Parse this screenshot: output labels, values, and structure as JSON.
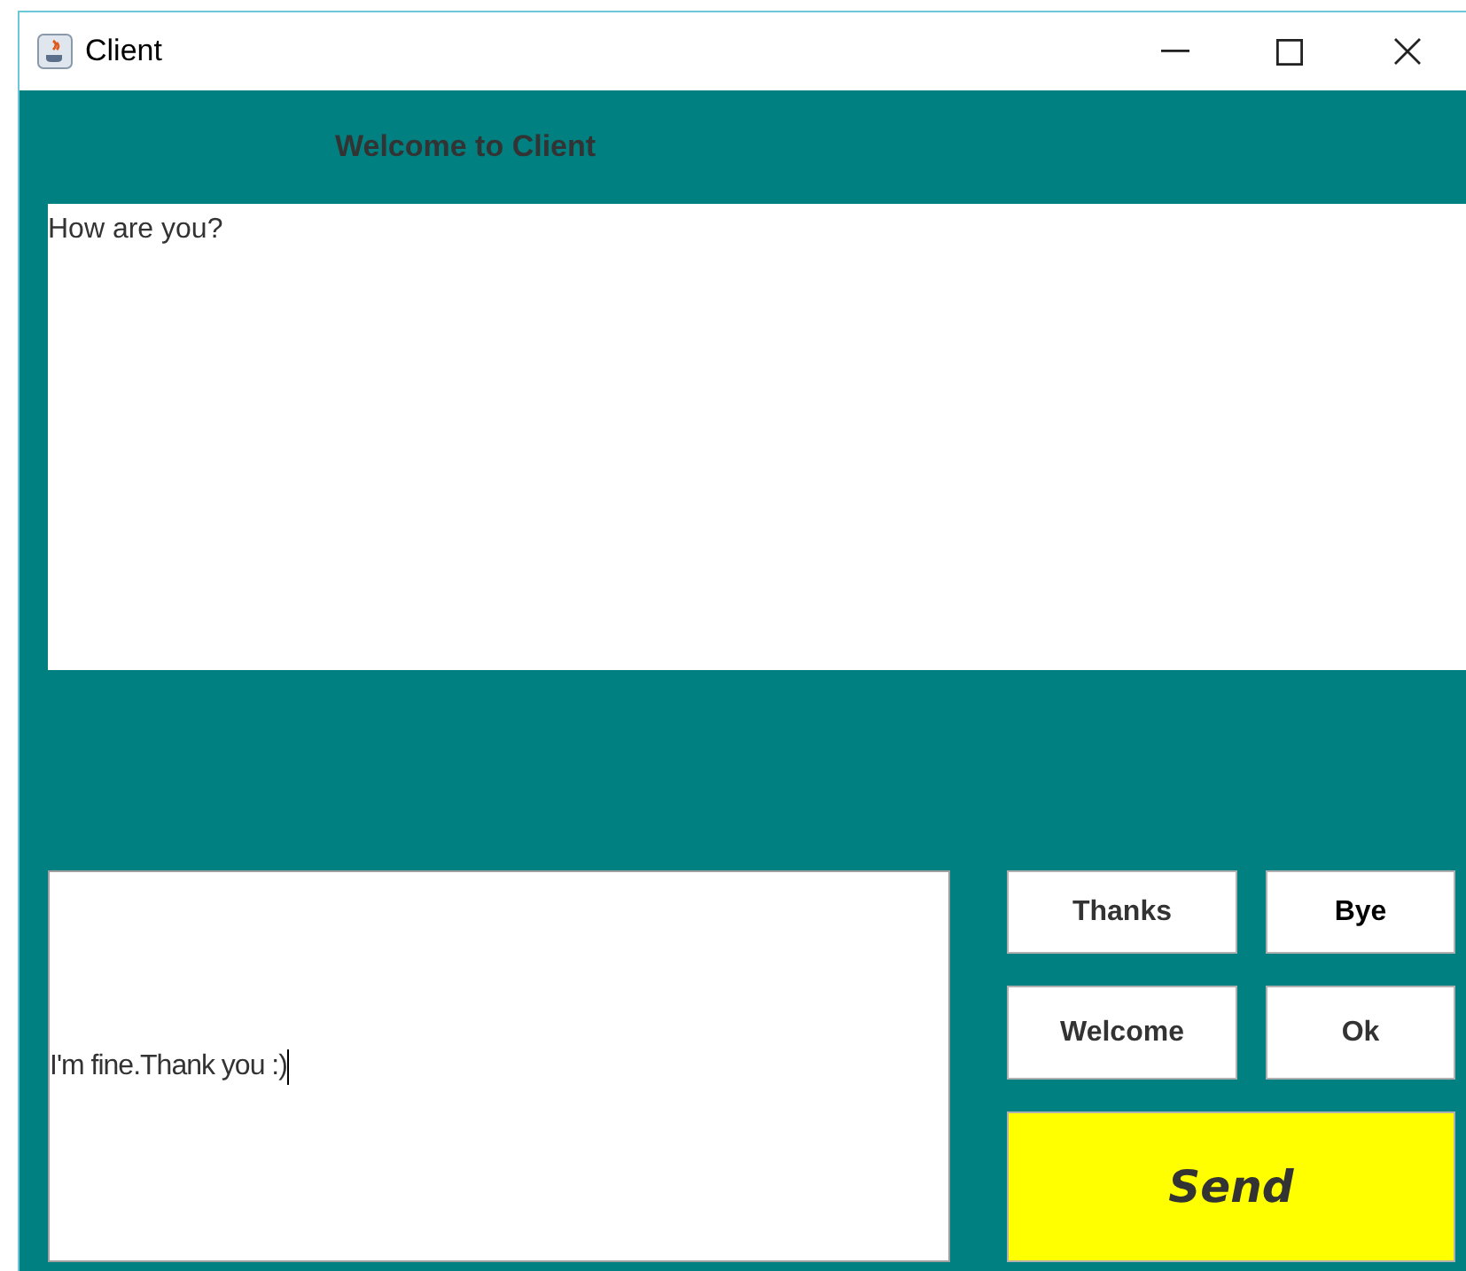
{
  "window": {
    "title": "Client"
  },
  "header": "Welcome to Client",
  "conversation": "How are you?",
  "message_input": {
    "value": "I'm fine.Thank you :)"
  },
  "quick_replies": [
    {
      "label": "Thanks",
      "emphasis": false
    },
    {
      "label": "Bye",
      "emphasis": true
    },
    {
      "label": "Welcome",
      "emphasis": false
    },
    {
      "label": "Ok",
      "emphasis": false
    }
  ],
  "send_button": "Send"
}
